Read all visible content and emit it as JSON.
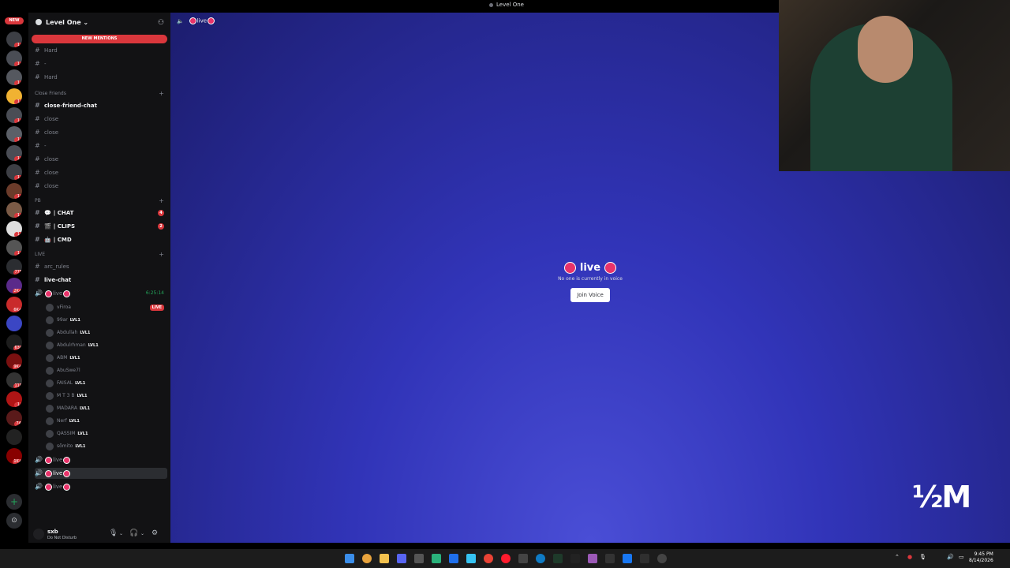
{
  "window": {
    "title": "Level One"
  },
  "rail": {
    "new_label": "NEW",
    "servers": [
      {
        "badge": "1"
      },
      {
        "badge": "1"
      },
      {
        "badge": "1"
      },
      {
        "badge": "1"
      },
      {
        "badge": "1"
      },
      {
        "badge": "1"
      },
      {
        "badge": "1"
      },
      {
        "badge": "1"
      },
      {
        "badge": "1"
      },
      {
        "badge": "1"
      },
      {
        "badge": "1"
      },
      {
        "badge": "1"
      },
      {
        "badge": "775"
      },
      {
        "badge": "2K+"
      },
      {
        "badge": "6K+"
      },
      {
        "badge": ""
      },
      {
        "badge": "634"
      },
      {
        "badge": "9K+"
      },
      {
        "badge": "110"
      },
      {
        "badge": "1"
      },
      {
        "badge": "74"
      },
      {
        "badge": ""
      },
      {
        "badge": "1K+"
      }
    ]
  },
  "guild": {
    "name": "Level One",
    "new_mentions": "NEW MENTIONS"
  },
  "channels_top": [
    {
      "name": "Hard"
    },
    {
      "name": "-"
    },
    {
      "name": "Hard"
    }
  ],
  "category_close_friends": "Close Friends",
  "close_friends": [
    {
      "name": "close-friend-chat",
      "bold": true
    },
    {
      "name": "close"
    },
    {
      "name": "close"
    },
    {
      "name": "-"
    },
    {
      "name": "close"
    },
    {
      "name": "close"
    },
    {
      "name": "close"
    }
  ],
  "category_pb": "PB",
  "pb": [
    {
      "name": "| CHAT",
      "emoji": "💬",
      "count": "4"
    },
    {
      "name": "| CLIPS",
      "emoji": "🎬",
      "count": "2"
    },
    {
      "name": "| CMD",
      "emoji": "🤖"
    }
  ],
  "category_live": "LIVE",
  "live_channels": [
    {
      "name": "arc_rules"
    },
    {
      "name": "live-chat"
    }
  ],
  "voice_live": {
    "name": "live",
    "timer": "6:25:14"
  },
  "voice_users": [
    {
      "name": "vFiroa",
      "live": "LIVE"
    },
    {
      "name": "99ar",
      "lvl": "LVL1"
    },
    {
      "name": "Abdullah",
      "lvl": "LVL1"
    },
    {
      "name": "Abdulrhman",
      "lvl": "LVL1"
    },
    {
      "name": "ABM",
      "lvl": "LVL1"
    },
    {
      "name": "AbuSwe7l"
    },
    {
      "name": "FAISAL",
      "lvl": "LVL1"
    },
    {
      "name": "M T 3 B",
      "lvl": "LVL1"
    },
    {
      "name": "MADARA",
      "lvl": "LVL1"
    },
    {
      "name": "Nerf",
      "lvl": "LVL1"
    },
    {
      "name": "QASSIM",
      "lvl": "LVL1"
    },
    {
      "name": "sõmito",
      "lvl": "LVL1"
    }
  ],
  "voice_others": [
    {
      "name": "live"
    },
    {
      "name": "live",
      "selected": true
    },
    {
      "name": "live"
    }
  ],
  "user_panel": {
    "name": "sxb",
    "status": "Do Not Disturb"
  },
  "main": {
    "header_channel": "live",
    "center_title": "live",
    "center_sub": "No one is currently in voice",
    "join_button": "Join Voice"
  },
  "overlay": {
    "text": "½M"
  },
  "taskbar": {
    "time": "9:45 PM",
    "date": "8/14/2026"
  },
  "colors": {
    "accent_red": "#da373c",
    "live_pink": "#e8336a",
    "background_blue": "#3134b8"
  }
}
